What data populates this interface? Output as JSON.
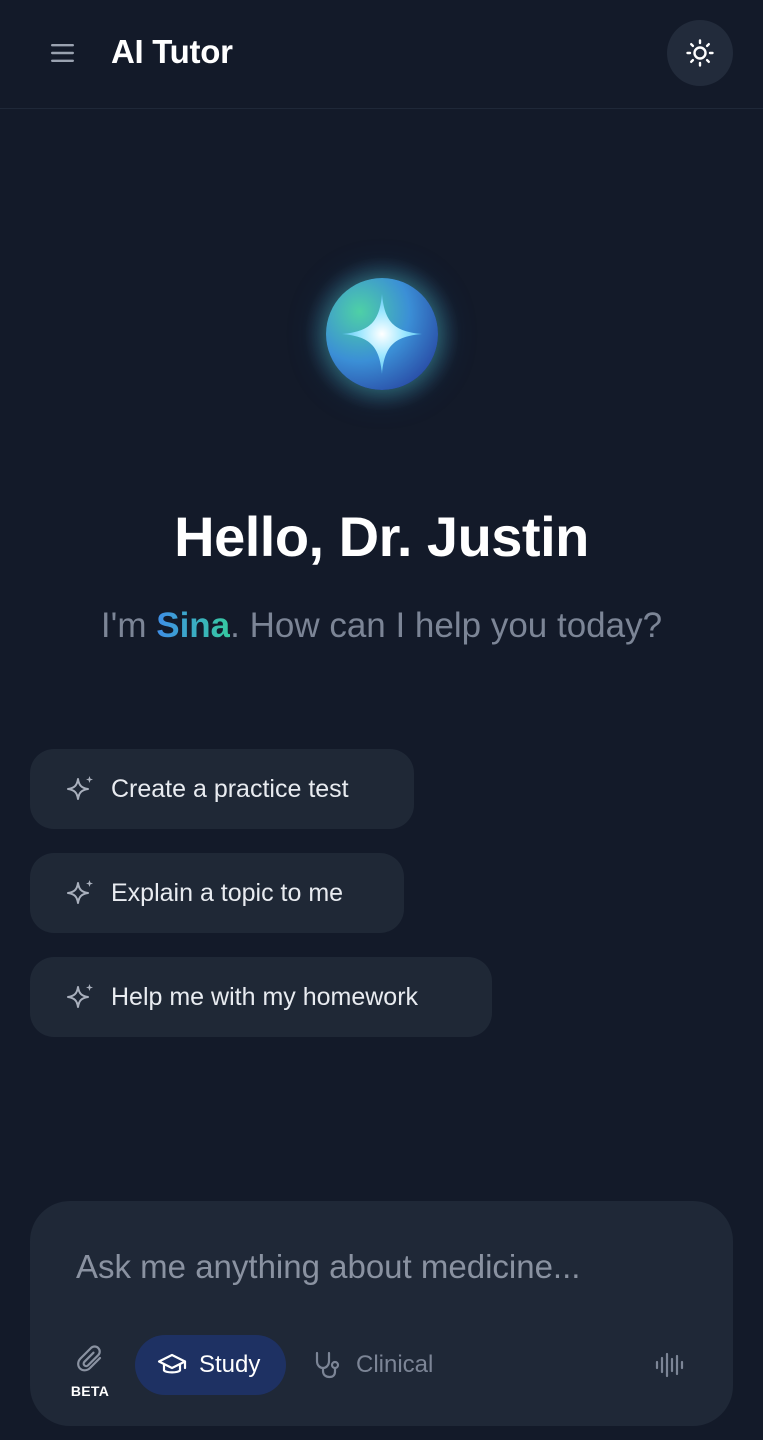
{
  "header": {
    "title": "AI Tutor",
    "menu_icon": "hamburger-menu-icon",
    "theme_icon": "sun-icon"
  },
  "welcome": {
    "greeting": "Hello, Dr. Justin",
    "subtitle_prefix": "I'm ",
    "assistant_name": "Sina",
    "subtitle_suffix": ". How can I help you today?"
  },
  "suggestions": [
    {
      "label": "Create a practice test",
      "icon": "sparkles-icon"
    },
    {
      "label": "Explain a topic to me",
      "icon": "sparkles-icon"
    },
    {
      "label": "Help me with my homework",
      "icon": "sparkles-icon"
    }
  ],
  "composer": {
    "placeholder": "Ask me anything about medicine...",
    "value": "",
    "attach_badge": "BETA",
    "modes": [
      {
        "label": "Study",
        "icon": "graduation-cap-icon",
        "selected": true
      },
      {
        "label": "Clinical",
        "icon": "stethoscope-icon",
        "selected": false
      }
    ],
    "voice_icon": "audio-waveform-icon"
  },
  "colors": {
    "background": "#131a29",
    "surface": "#1f2836",
    "accent_blue": "#3f8ee8",
    "accent_green": "#36c9a0",
    "study_chip": "#1e3163",
    "muted_text": "#7c8596"
  }
}
